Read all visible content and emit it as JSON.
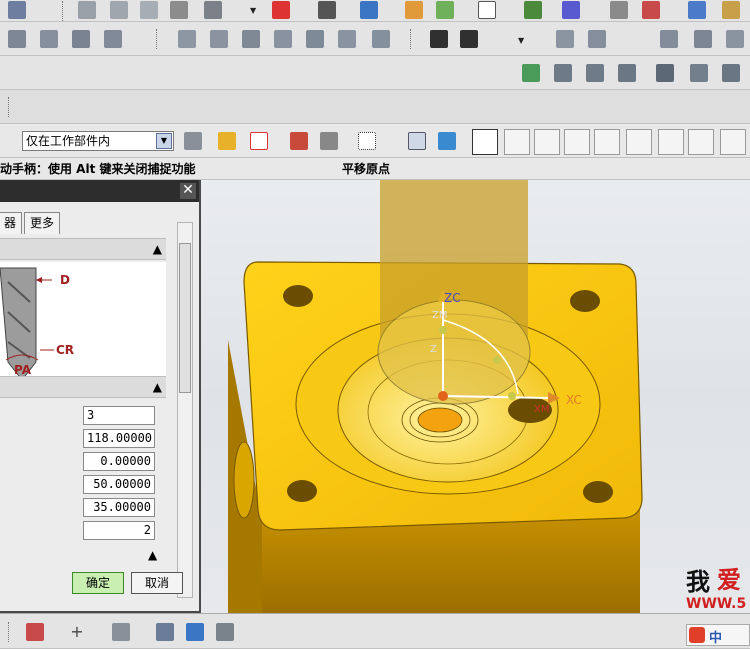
{
  "selection_bar": {
    "filter_value": "仅在工作部件内"
  },
  "cue_line": {
    "prompt": "动手柄：使用 Alt 键来关闭捕捉功能",
    "status": "平移原点"
  },
  "dialog": {
    "tabs": [
      "器",
      "更多"
    ],
    "drill_labels": {
      "d": "D",
      "cr": "CR",
      "pa": "PA"
    },
    "params": [
      "3",
      "118.00000",
      "0.00000",
      "50.00000",
      "35.00000",
      "2"
    ],
    "ok_label": "确定",
    "cancel_label": "取消"
  },
  "viewport": {
    "triad": {
      "zc": "ZC",
      "xc": "XC",
      "zm": "ZM",
      "xm": "XM",
      "zc2": "Z"
    }
  },
  "watermark": {
    "line1": "我",
    "line1b": "爱",
    "line2": "WWW.5"
  },
  "ime": {
    "label": "中"
  },
  "colors": {
    "part": "#f5c60f",
    "tool": "#c9a632",
    "accent_green": "#2fd12f"
  }
}
